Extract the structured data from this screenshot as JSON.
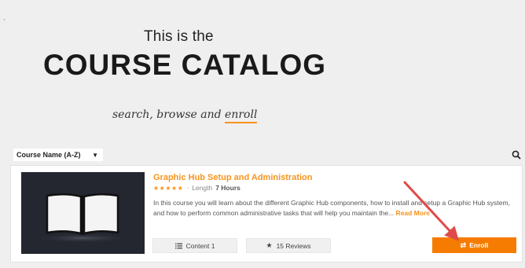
{
  "hero": {
    "subtitle": "This is the",
    "title": "COURSE CATALOG",
    "tagline_prefix": "search, browse and ",
    "tagline_emphasis": "enroll"
  },
  "toolbar": {
    "sort_value": "Course Name (A-Z)",
    "sort_icon": "chevron-down-icon",
    "search_icon": "search-icon"
  },
  "course": {
    "title": "Graphic Hub Setup and Administration",
    "rating": 5,
    "length_label": "Length",
    "length_value": "7 Hours",
    "description": "In this course you will learn about the different Graphic Hub components, how to install and setup a Graphic Hub system, and how to perform common administrative tasks that will help you maintain the...",
    "read_more": "Read More",
    "content_label": "Content 1",
    "reviews_label": "15 Reviews",
    "enroll_label": "Enroll",
    "thumbnail_icon": "open-book-icon"
  },
  "colors": {
    "accent": "#f7941d",
    "enroll_button": "#f57c00",
    "thumbnail_bg": "#242630",
    "annotation_arrow": "#e04a4a",
    "page_bg": "#efefef"
  }
}
